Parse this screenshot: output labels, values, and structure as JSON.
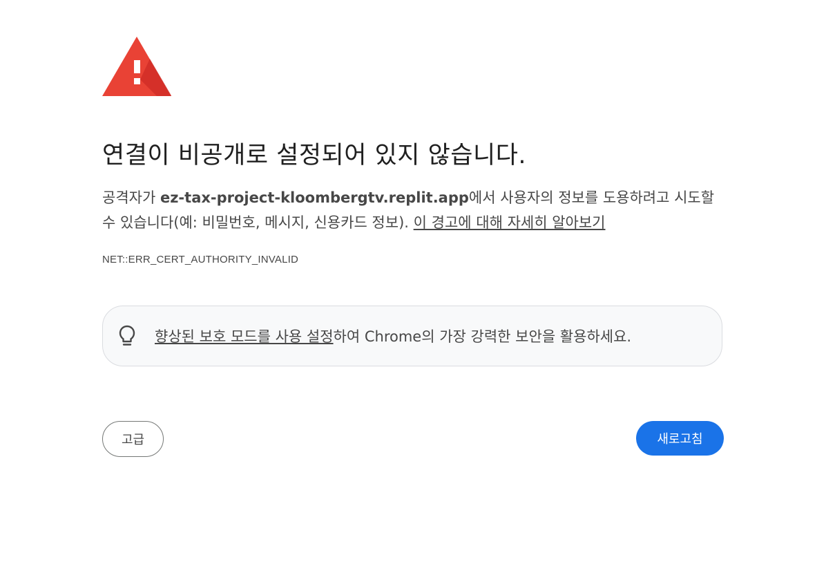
{
  "title": "연결이 비공개로 설정되어 있지 않습니다.",
  "description": {
    "prefix": "공격자가 ",
    "domain": "ez-tax-project-kloombergtv.replit.app",
    "suffix": "에서 사용자의 정보를 도용하려고 시도할 수 있습니다(예: 비밀번호, 메시지, 신용카드 정보). ",
    "learn_more_link": "이 경고에 대해 자세히 알아보기"
  },
  "error_code": "NET::ERR_CERT_AUTHORITY_INVALID",
  "enhanced_protection": {
    "icon": "lightbulb-icon",
    "link_text": "향상된 보호 모드를 사용 설정",
    "suffix": "하여 Chrome의 가장 강력한 보안을 활용하세요."
  },
  "buttons": {
    "advanced_label": "고급",
    "reload_label": "새로고침"
  },
  "colors": {
    "warning_red": "#e94235",
    "warning_shadow": "#c5221f",
    "primary_blue": "#1a73e8",
    "box_background": "#f8f9fa"
  }
}
